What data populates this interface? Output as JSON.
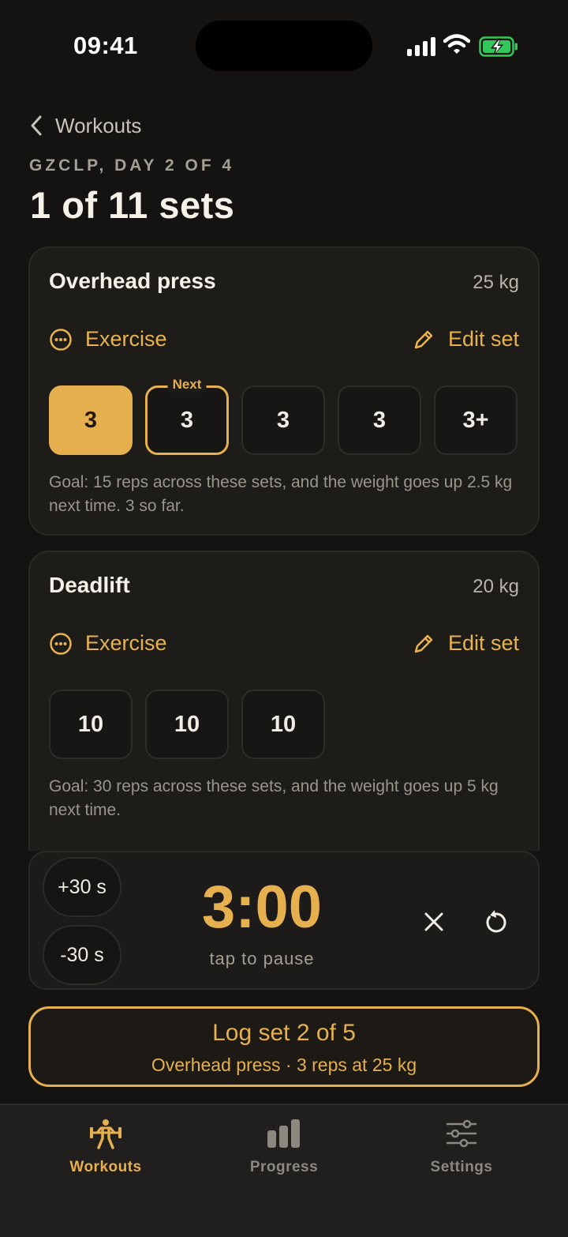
{
  "status_bar": {
    "time": "09:41"
  },
  "header": {
    "back_label": "Workouts",
    "program": "GZCLP, DAY 2 OF 4",
    "title": "1 of 11 sets"
  },
  "exercises": [
    {
      "name": "Overhead press",
      "weight": "25 kg",
      "exercise_label": "Exercise",
      "edit_label": "Edit set",
      "next_label": "Next",
      "sets": [
        "3",
        "3",
        "3",
        "3",
        "3+"
      ],
      "sets_completed": 1,
      "goal": "Goal: 15 reps across these sets, and the weight goes up 2.5 kg next time. 3 so far."
    },
    {
      "name": "Deadlift",
      "weight": "20 kg",
      "exercise_label": "Exercise",
      "edit_label": "Edit set",
      "sets": [
        "10",
        "10",
        "10"
      ],
      "sets_completed": 0,
      "goal": "Goal: 30 reps across these sets, and the weight goes up 5 kg next time."
    }
  ],
  "timer": {
    "plus_label": "+30 s",
    "minus_label": "-30 s",
    "value": "3:00",
    "hint": "tap to pause"
  },
  "log_button": {
    "title": "Log set 2 of 5",
    "subtitle": "Overhead press · 3 reps at 25 kg"
  },
  "tabs": [
    {
      "label": "Workouts",
      "icon": "weightlifter-icon",
      "active": true
    },
    {
      "label": "Progress",
      "icon": "bar-chart-icon",
      "active": false
    },
    {
      "label": "Settings",
      "icon": "sliders-icon",
      "active": false
    }
  ],
  "colors": {
    "accent": "#e6b04e",
    "background": "#141311",
    "card": "#1e1c19",
    "battery_green": "#34c759"
  }
}
